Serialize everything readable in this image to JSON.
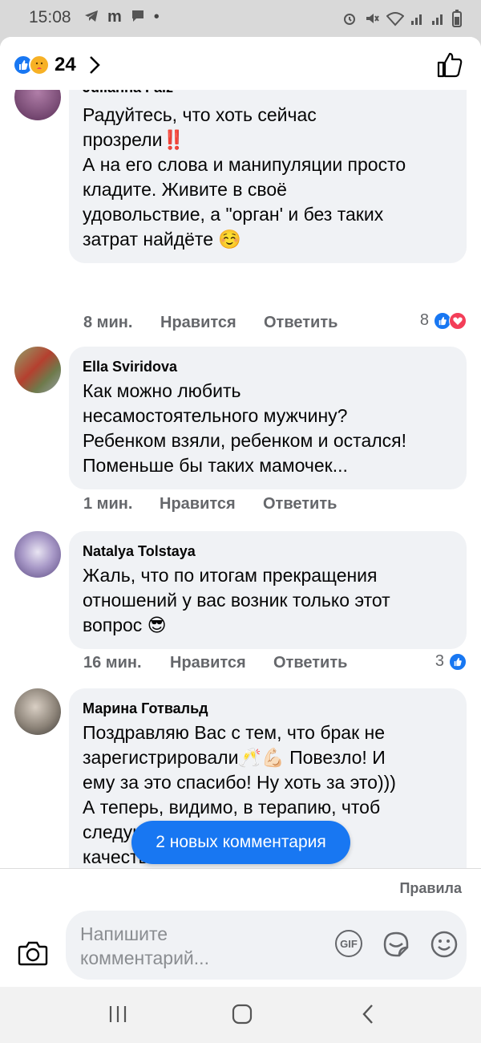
{
  "status": {
    "time": "15:08",
    "left_icons": [
      "telegram-icon",
      "m-icon",
      "message-icon",
      "dot"
    ],
    "right_icons": [
      "alarm-icon",
      "mute-icon",
      "wifi-icon",
      "signal-icon",
      "signal-icon",
      "battery-icon"
    ]
  },
  "header": {
    "reaction_count": "24"
  },
  "comments": [
    {
      "name": "Julianna Falz",
      "text": "Радуйтесь, что хоть сейчас\nпрозрели‼️\nА на его слова и манипуляции просто\nкладите. Живите в своё\nудовольствие, а \"орган' и без таких\nзатрат найдёте ☺️",
      "time": "8 мин.",
      "like": "Нравится",
      "reply": "Ответить",
      "reactions": "8"
    },
    {
      "name": "Ella Sviridova",
      "text": "Как можно любить\nнесамостоятельного мужчину?\nРебенком взяли, ребенком и остался!\nПоменьше бы таких мамочек...",
      "time": "1 мин.",
      "like": "Нравится",
      "reply": "Ответить",
      "reactions": ""
    },
    {
      "name": "Natalya Tolstaya",
      "text": "Жаль, что по итогам прекращения\nотношений у вас возник только этот\nвопрос 😎",
      "time": "16 мин.",
      "like": "Нравится",
      "reply": "Ответить",
      "reactions": "3"
    },
    {
      "name": "Марина Готвальд",
      "text": "Поздравляю Вас с тем, что брак не\nзарегистрировали🥂💪🏻 Повезло! И\nему за это спасибо! Ну хоть за это)))\nА теперь, видимо, в терапию, чтоб\nследующие отношения были\nкачественными.\nИ ещё\nВ          )))  П        ! Ш",
      "time": "",
      "like": "",
      "reply": "",
      "reactions": ""
    }
  ],
  "new_comments_label": "2 новых комментария",
  "composer": {
    "rules": "Правила",
    "placeholder": "Напишите\nкомментарий...",
    "gif": "GIF"
  },
  "colors": {
    "accent": "#1877f2",
    "bubble": "#f0f2f5",
    "muted": "#65676b",
    "heart": "#f33e58"
  }
}
